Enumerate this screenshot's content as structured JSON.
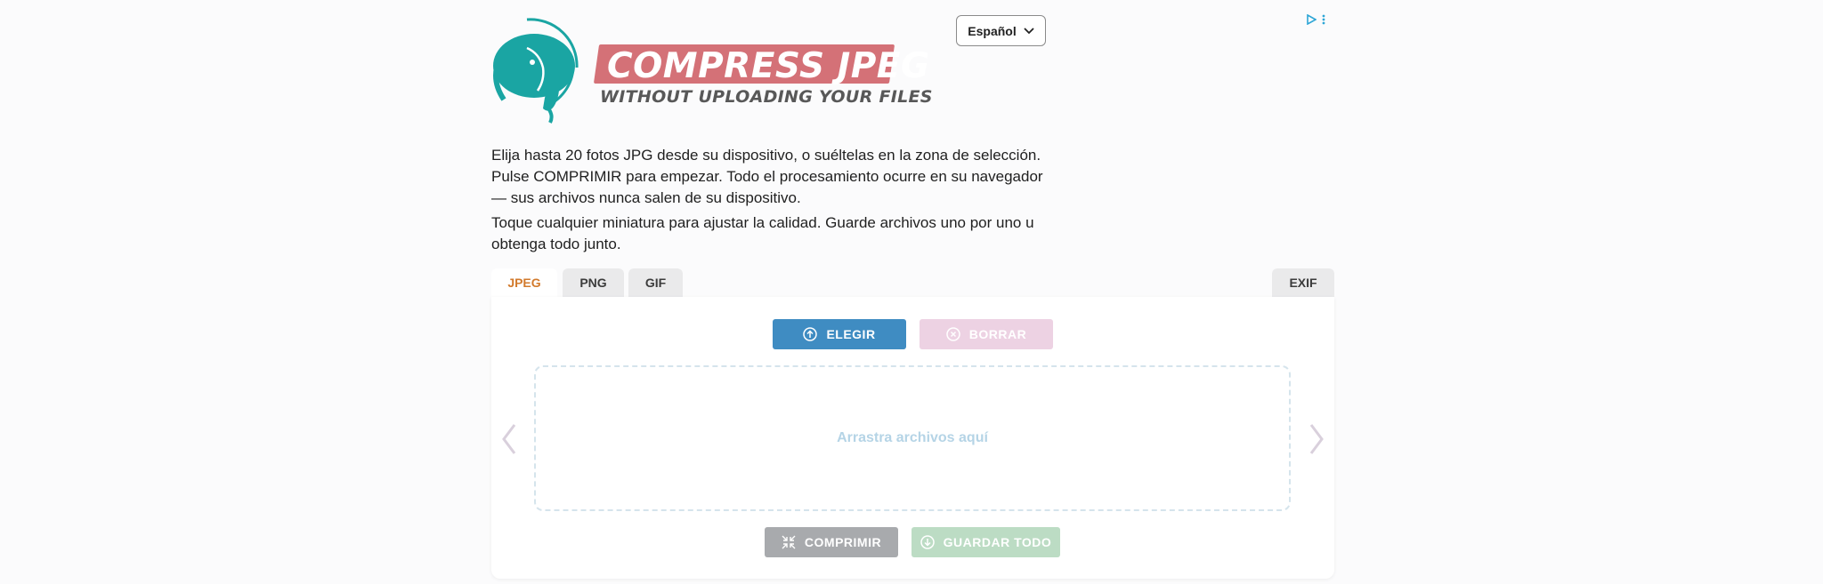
{
  "header": {
    "logo_title": "COMPRESS JPEG",
    "logo_subtitle": "WITHOUT UPLOADING YOUR FILES",
    "language": "Español"
  },
  "intro": {
    "paragraph1": "Elija hasta 20 fotos JPG desde su dispositivo, o suéltelas en la zona de selección. Pulse COMPRIMIR para empezar. Todo el procesamiento ocurre en su navegador — sus archivos nunca salen de su dispositivo.",
    "paragraph2": "Toque cualquier miniatura para ajustar la calidad. Guarde archivos uno por uno u obtenga todo junto."
  },
  "tabs": [
    {
      "label": "JPEG",
      "active": true
    },
    {
      "label": "PNG",
      "active": false
    },
    {
      "label": "GIF",
      "active": false
    }
  ],
  "exif_tab": "EXIF",
  "toolbar": {
    "choose_label": "ELEGIR",
    "clear_label": "BORRAR",
    "compress_label": "COMPRIMIR",
    "save_all_label": "GUARDAR TODO"
  },
  "dropzone": {
    "text": "Arrastra archivos aquí"
  },
  "colors": {
    "accent_orange": "#d27a2c",
    "choose_blue": "#3f8cc2",
    "clear_pink": "#edd2e3",
    "compress_gray": "#a8aaad",
    "save_green": "#bcdcc4",
    "logo_teal": "#1aa5a3",
    "logo_red": "#d47177"
  },
  "icons": {
    "elephant_logo": "elephant-icon",
    "choose": "upload-circle-icon",
    "clear": "close-circle-icon",
    "compress": "compress-arrows-icon",
    "save_all": "download-circle-icon",
    "ad_choices": "adchoices-icon",
    "ad_menu": "kebab-menu-icon"
  }
}
